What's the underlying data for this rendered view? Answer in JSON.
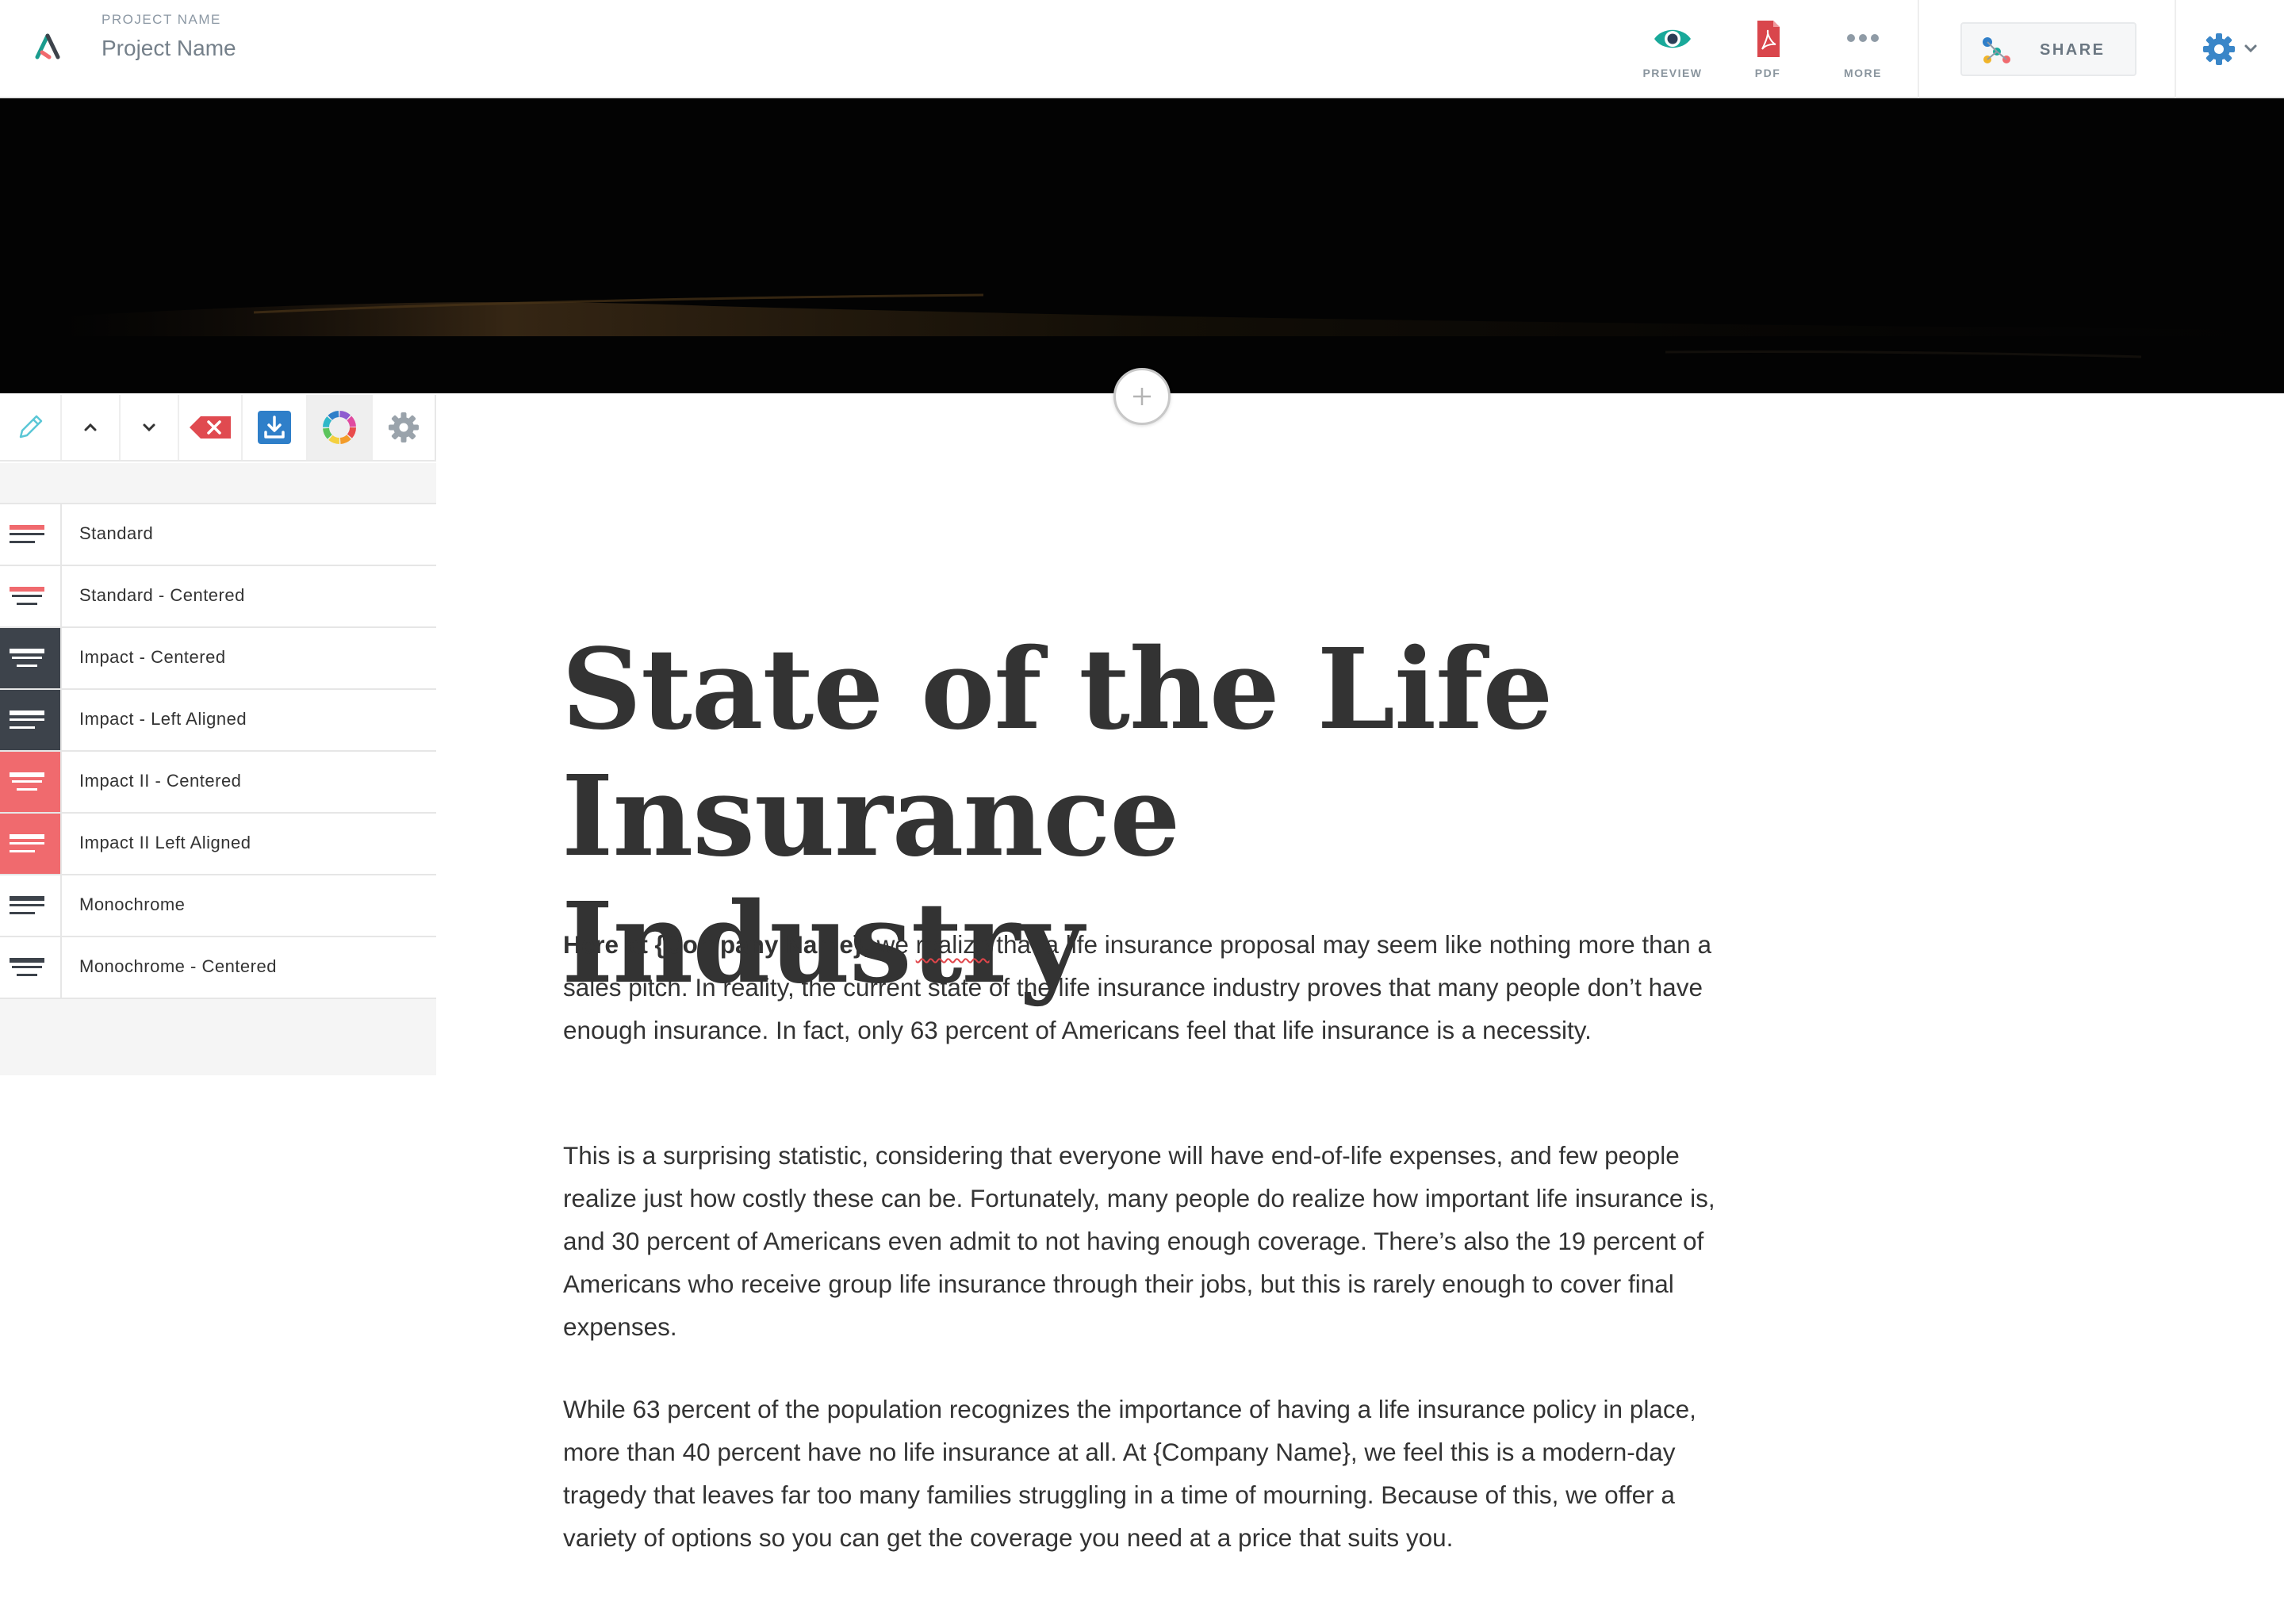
{
  "header": {
    "project_label": "PROJECT NAME",
    "project_name": "Project Name",
    "tools": {
      "preview": "PREVIEW",
      "pdf": "PDF",
      "more": "MORE"
    },
    "share_label": "SHARE"
  },
  "icons": {
    "logo": "app-logo",
    "preview": "eye-icon",
    "pdf": "pdf-icon",
    "more": "more-dots-icon",
    "share": "share-icon",
    "settings": "gear-icon",
    "add": "plus-icon",
    "edit": "pencil-icon",
    "move_up": "chevron-up-icon",
    "move_down": "chevron-down-icon",
    "delete": "delete-icon",
    "save": "download-icon",
    "theme": "color-wheel-icon",
    "block_settings": "gear-icon"
  },
  "colors": {
    "accent_teal": "#19a99a",
    "pdf_red": "#d9464c",
    "coral": "#f06a6e",
    "dark_slate": "#3d434b",
    "blue": "#2f7fc9"
  },
  "theme_panel": {
    "themes": [
      {
        "label": "Standard",
        "style": "standard"
      },
      {
        "label": "Standard - Centered",
        "style": "standard-centered"
      },
      {
        "label": "Impact - Centered",
        "style": "impact-centered"
      },
      {
        "label": "Impact - Left Aligned",
        "style": "impact-left"
      },
      {
        "label": "Impact II - Centered",
        "style": "impact2-centered"
      },
      {
        "label": "Impact II Left Aligned",
        "style": "impact2-left"
      },
      {
        "label": "Monochrome",
        "style": "mono"
      },
      {
        "label": "Monochrome - Centered",
        "style": "mono-centered"
      }
    ]
  },
  "document": {
    "title": "State of the Life Insurance Industry",
    "p1_bold": "Here at {Company Name},",
    "p1_pre": " we ",
    "p1_misspelled": "realize",
    "p1_rest": " that a life insurance proposal may seem like nothing more than a sales pitch. In reality, the current state of the life insurance industry proves that many people don’t have enough insurance. In fact, only 63 percent of Americans feel that life insurance is a necessity.",
    "p2": "This is a surprising statistic, considering that everyone will have end-of-life expenses, and few people realize just how costly these can be. Fortunately, many people do realize how important life insurance is, and 30 percent of Americans even admit to not having enough coverage. There’s also the 19 percent of Americans who receive group life insurance through their jobs, but this is rarely enough to cover final expenses.",
    "p3": "While 63 percent of the population recognizes the importance of having a life insurance policy in place, more than 40 percent have no life insurance at all. At {Company Name}, we feel this is a modern-day tragedy that leaves far too many families struggling in a time of mourning. Because of this, we offer a variety of options so you can get the coverage you need at a price that suits you."
  }
}
